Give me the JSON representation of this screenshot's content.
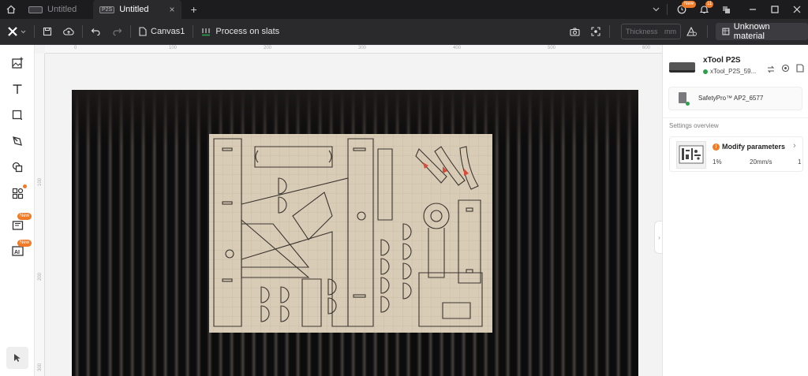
{
  "titlebar": {
    "tabs": [
      {
        "badge": "",
        "label": "Untitled",
        "active": false
      },
      {
        "badge": "P2S",
        "label": "Untitled",
        "active": true
      }
    ],
    "new_badge": "New",
    "notif_count": "11"
  },
  "toolbar": {
    "canvas_name": "Canvas1",
    "process_mode": "Process on slats",
    "thickness_placeholder": "Thickness",
    "thickness_unit": "mm",
    "material": "Unknown material"
  },
  "left_tools": {
    "new_badge_1": "New",
    "new_badge_2": "New"
  },
  "ruler": {
    "top_ticks": [
      "0",
      "100",
      "200",
      "300",
      "400",
      "500",
      "600"
    ],
    "left_ticks": [
      "100",
      "200",
      "300"
    ]
  },
  "device": {
    "name": "xTool P2S",
    "id": "xTool_P2S_59...",
    "status_color": "#2aa14a",
    "accessory": "SafetyPro™ AP2_6577"
  },
  "settings": {
    "heading": "Settings overview",
    "item_label": "Modify parameters",
    "power": "1%",
    "speed": "20mm/s",
    "passes": "1",
    "warning_color": "#f07a25"
  }
}
